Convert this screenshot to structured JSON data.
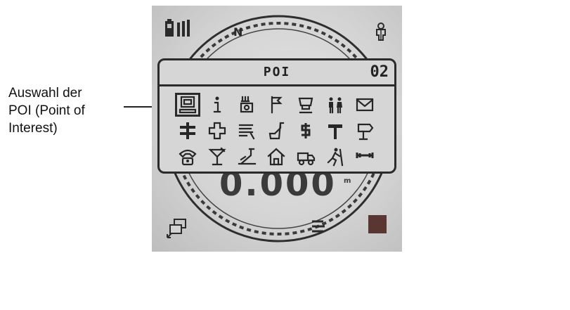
{
  "annotation": {
    "text": "Auswahl der\nPOI (Point of\nInterest)"
  },
  "screen": {
    "compass_label": "N",
    "distance": {
      "value": "0.000",
      "unit": "m"
    }
  },
  "poi_menu": {
    "title": "POI",
    "page": "02",
    "selected_index": 0,
    "icons": [
      "computer-icon",
      "info-icon",
      "restaurant-icon",
      "flag-icon",
      "shop-icon",
      "toilet-icon",
      "mail-icon",
      "crossroads-icon",
      "first-aid-icon",
      "bed-icon",
      "water-icon",
      "dollar-icon",
      "hammer-icon",
      "signpost-icon",
      "phone-icon",
      "cocktail-icon",
      "pool-icon",
      "house-icon",
      "car-icon",
      "hiking-icon",
      "wrench-icon"
    ]
  }
}
